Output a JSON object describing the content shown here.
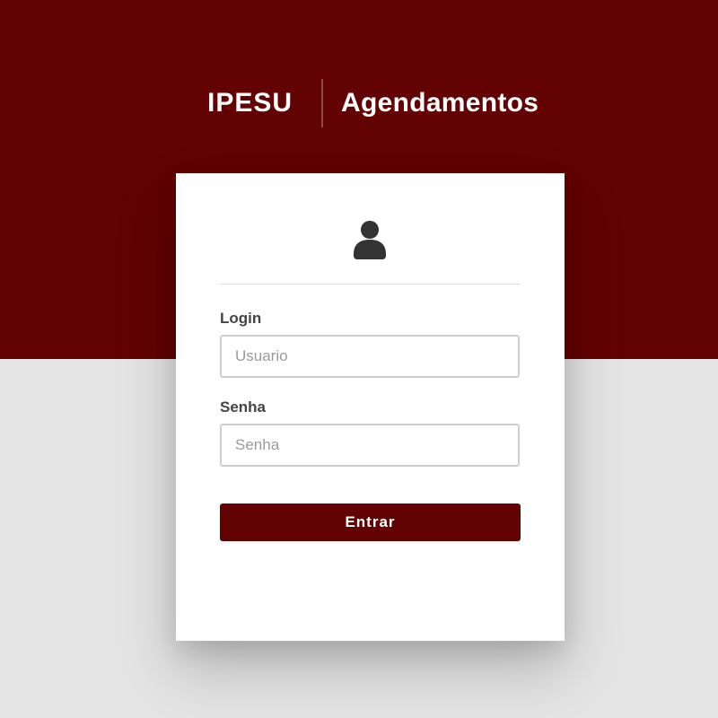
{
  "header": {
    "brand": "IPESU",
    "title": "Agendamentos"
  },
  "card": {
    "icon": "user-icon",
    "login": {
      "label": "Login",
      "placeholder": "Usuario",
      "value": ""
    },
    "password": {
      "label": "Senha",
      "placeholder": "Senha",
      "value": ""
    },
    "submit_label": "Entrar"
  },
  "colors": {
    "brand_dark_red": "#620202",
    "page_background": "#e4e4e4",
    "card_background": "#ffffff",
    "input_border": "#cfcfcf",
    "label_text": "#444444",
    "icon": "#333333"
  }
}
